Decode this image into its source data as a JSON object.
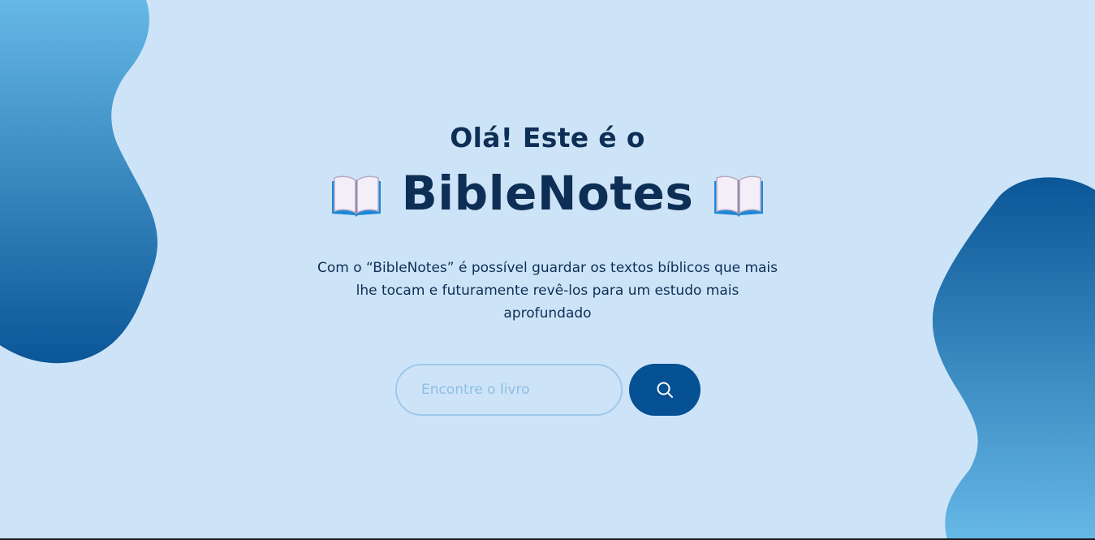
{
  "hero": {
    "greeting": "Olá! Este é o",
    "title": "BibleNotes",
    "title_icon": "open-book-icon",
    "description": "Com o “BibleNotes” é possível guardar os textos bíblicos que mais lhe tocam e futuramente revê-los para um estudo mais aprofundado"
  },
  "search": {
    "placeholder": "Encontre o livro",
    "value": "",
    "button_icon": "search-icon"
  },
  "colors": {
    "background": "#cde4f8",
    "text": "#0e2f55",
    "accent": "#065094",
    "blob_light": "#63b4e2",
    "blob_dark": "#0b5697"
  }
}
